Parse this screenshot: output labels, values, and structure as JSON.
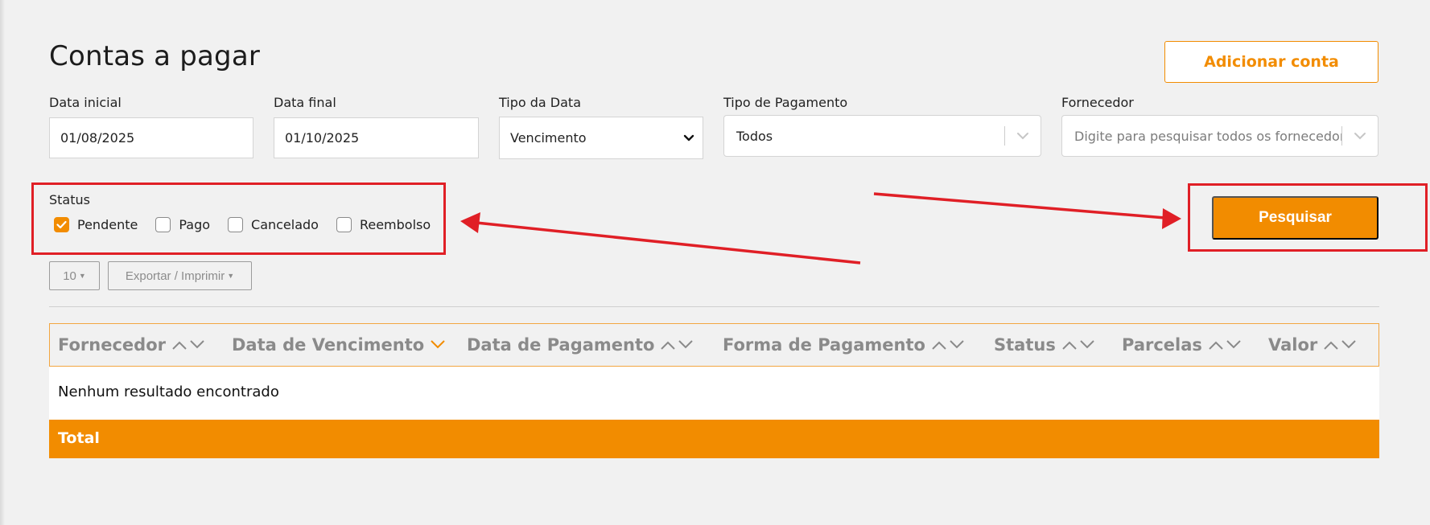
{
  "page": {
    "title": "Contas a pagar",
    "add_button": "Adicionar conta"
  },
  "filters": {
    "start_date": {
      "label": "Data inicial",
      "value": "01/08/2025"
    },
    "end_date": {
      "label": "Data final",
      "value": "01/10/2025"
    },
    "date_type": {
      "label": "Tipo da Data",
      "value": "Vencimento"
    },
    "payment_type": {
      "label": "Tipo de Pagamento",
      "value": "Todos"
    },
    "supplier": {
      "label": "Fornecedor",
      "placeholder": "Digite para pesquisar todos os fornecedores"
    },
    "status": {
      "label": "Status",
      "options": [
        {
          "label": "Pendente",
          "checked": true
        },
        {
          "label": "Pago",
          "checked": false
        },
        {
          "label": "Cancelado",
          "checked": false
        },
        {
          "label": "Reembolso",
          "checked": false
        }
      ]
    },
    "search_button": "Pesquisar"
  },
  "toolbar": {
    "page_size": "10",
    "export": "Exportar / Imprimir"
  },
  "table": {
    "columns": [
      {
        "label": "Fornecedor",
        "sort": "none"
      },
      {
        "label": "Data de Vencimento",
        "sort": "desc"
      },
      {
        "label": "Data de Pagamento",
        "sort": "none"
      },
      {
        "label": "Forma de Pagamento",
        "sort": "none"
      },
      {
        "label": "Status",
        "sort": "none"
      },
      {
        "label": "Parcelas",
        "sort": "none"
      },
      {
        "label": "Valor",
        "sort": "none"
      }
    ],
    "empty_message": "Nenhum resultado encontrado",
    "total_label": "Total"
  },
  "colors": {
    "accent": "#f28c00",
    "annotation_red": "#e01f26",
    "background": "#f1f1f1"
  }
}
